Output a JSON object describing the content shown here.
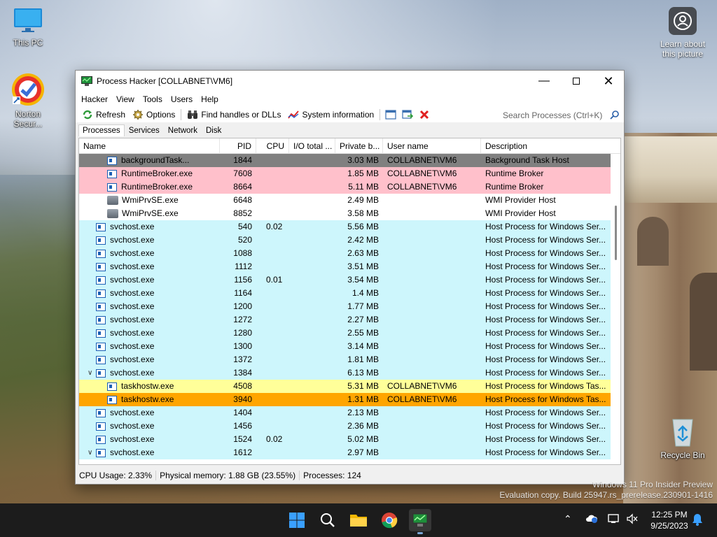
{
  "desktop": {
    "icons": [
      {
        "name": "This PC"
      },
      {
        "name": "Norton Secur..."
      },
      {
        "name": "Recycle Bin"
      }
    ],
    "learn_about": "Learn about this picture"
  },
  "window": {
    "title": "Process Hacker [COLLABNET\\VM6]",
    "menu": [
      "Hacker",
      "View",
      "Tools",
      "Users",
      "Help"
    ],
    "toolbar": {
      "refresh": "Refresh",
      "options": "Options",
      "find_handles": "Find handles or DLLs",
      "system_info": "System information",
      "search_placeholder": "Search Processes (Ctrl+K)"
    },
    "tabs": [
      "Processes",
      "Services",
      "Network",
      "Disk"
    ],
    "columns": [
      "Name",
      "PID",
      "CPU",
      "I/O total ...",
      "Private b...",
      "User name",
      "Description"
    ],
    "rows": [
      {
        "name": "backgroundTask...",
        "pid": "1844",
        "cpu": "",
        "io": "",
        "priv": "3.03 MB",
        "user": "COLLABNET\\VM6",
        "desc": "Background Task Host"
      },
      {
        "name": "RuntimeBroker.exe",
        "pid": "7608",
        "cpu": "",
        "io": "",
        "priv": "1.85 MB",
        "user": "COLLABNET\\VM6",
        "desc": "Runtime Broker"
      },
      {
        "name": "RuntimeBroker.exe",
        "pid": "8664",
        "cpu": "",
        "io": "",
        "priv": "5.11 MB",
        "user": "COLLABNET\\VM6",
        "desc": "Runtime Broker"
      },
      {
        "name": "WmiPrvSE.exe",
        "pid": "6648",
        "cpu": "",
        "io": "",
        "priv": "2.49 MB",
        "user": "",
        "desc": "WMI Provider Host"
      },
      {
        "name": "WmiPrvSE.exe",
        "pid": "8852",
        "cpu": "",
        "io": "",
        "priv": "3.58 MB",
        "user": "",
        "desc": "WMI Provider Host"
      },
      {
        "name": "svchost.exe",
        "pid": "540",
        "cpu": "0.02",
        "io": "",
        "priv": "5.56 MB",
        "user": "",
        "desc": "Host Process for Windows Ser..."
      },
      {
        "name": "svchost.exe",
        "pid": "520",
        "cpu": "",
        "io": "",
        "priv": "2.42 MB",
        "user": "",
        "desc": "Host Process for Windows Ser..."
      },
      {
        "name": "svchost.exe",
        "pid": "1088",
        "cpu": "",
        "io": "",
        "priv": "2.63 MB",
        "user": "",
        "desc": "Host Process for Windows Ser..."
      },
      {
        "name": "svchost.exe",
        "pid": "1112",
        "cpu": "",
        "io": "",
        "priv": "3.51 MB",
        "user": "",
        "desc": "Host Process for Windows Ser..."
      },
      {
        "name": "svchost.exe",
        "pid": "1156",
        "cpu": "0.01",
        "io": "",
        "priv": "3.54 MB",
        "user": "",
        "desc": "Host Process for Windows Ser..."
      },
      {
        "name": "svchost.exe",
        "pid": "1164",
        "cpu": "",
        "io": "",
        "priv": "1.4 MB",
        "user": "",
        "desc": "Host Process for Windows Ser..."
      },
      {
        "name": "svchost.exe",
        "pid": "1200",
        "cpu": "",
        "io": "",
        "priv": "1.77 MB",
        "user": "",
        "desc": "Host Process for Windows Ser..."
      },
      {
        "name": "svchost.exe",
        "pid": "1272",
        "cpu": "",
        "io": "",
        "priv": "2.27 MB",
        "user": "",
        "desc": "Host Process for Windows Ser..."
      },
      {
        "name": "svchost.exe",
        "pid": "1280",
        "cpu": "",
        "io": "",
        "priv": "2.55 MB",
        "user": "",
        "desc": "Host Process for Windows Ser..."
      },
      {
        "name": "svchost.exe",
        "pid": "1300",
        "cpu": "",
        "io": "",
        "priv": "3.14 MB",
        "user": "",
        "desc": "Host Process for Windows Ser..."
      },
      {
        "name": "svchost.exe",
        "pid": "1372",
        "cpu": "",
        "io": "",
        "priv": "1.81 MB",
        "user": "",
        "desc": "Host Process for Windows Ser..."
      },
      {
        "name": "svchost.exe",
        "pid": "1384",
        "cpu": "",
        "io": "",
        "priv": "6.13 MB",
        "user": "",
        "desc": "Host Process for Windows Ser..."
      },
      {
        "name": "taskhostw.exe",
        "pid": "4508",
        "cpu": "",
        "io": "",
        "priv": "5.31 MB",
        "user": "COLLABNET\\VM6",
        "desc": "Host Process for Windows Tas..."
      },
      {
        "name": "taskhostw.exe",
        "pid": "3940",
        "cpu": "",
        "io": "",
        "priv": "1.31 MB",
        "user": "COLLABNET\\VM6",
        "desc": "Host Process for Windows Tas..."
      },
      {
        "name": "svchost.exe",
        "pid": "1404",
        "cpu": "",
        "io": "",
        "priv": "2.13 MB",
        "user": "",
        "desc": "Host Process for Windows Ser..."
      },
      {
        "name": "svchost.exe",
        "pid": "1456",
        "cpu": "",
        "io": "",
        "priv": "2.36 MB",
        "user": "",
        "desc": "Host Process for Windows Ser..."
      },
      {
        "name": "svchost.exe",
        "pid": "1524",
        "cpu": "0.02",
        "io": "",
        "priv": "5.02 MB",
        "user": "",
        "desc": "Host Process for Windows Ser..."
      },
      {
        "name": "svchost.exe",
        "pid": "1612",
        "cpu": "",
        "io": "",
        "priv": "2.97 MB",
        "user": "",
        "desc": "Host Process for Windows Ser..."
      }
    ],
    "status": {
      "cpu": "CPU Usage: 2.33%",
      "memory": "Physical memory: 1.88 GB (23.55%)",
      "processes": "Processes: 124"
    }
  },
  "watermark": {
    "line1": "Windows 11 Pro Insider Preview",
    "line2": "Evaluation copy. Build 25947.rs_prerelease.230901-1416"
  },
  "taskbar": {
    "time": "12:25 PM",
    "date": "9/25/2023"
  },
  "colors": {
    "pink": "#ffc0cb",
    "cyan": "#cdf6fc",
    "yellow": "#ffff99",
    "orange": "#ffa500",
    "gray": "#808080"
  }
}
